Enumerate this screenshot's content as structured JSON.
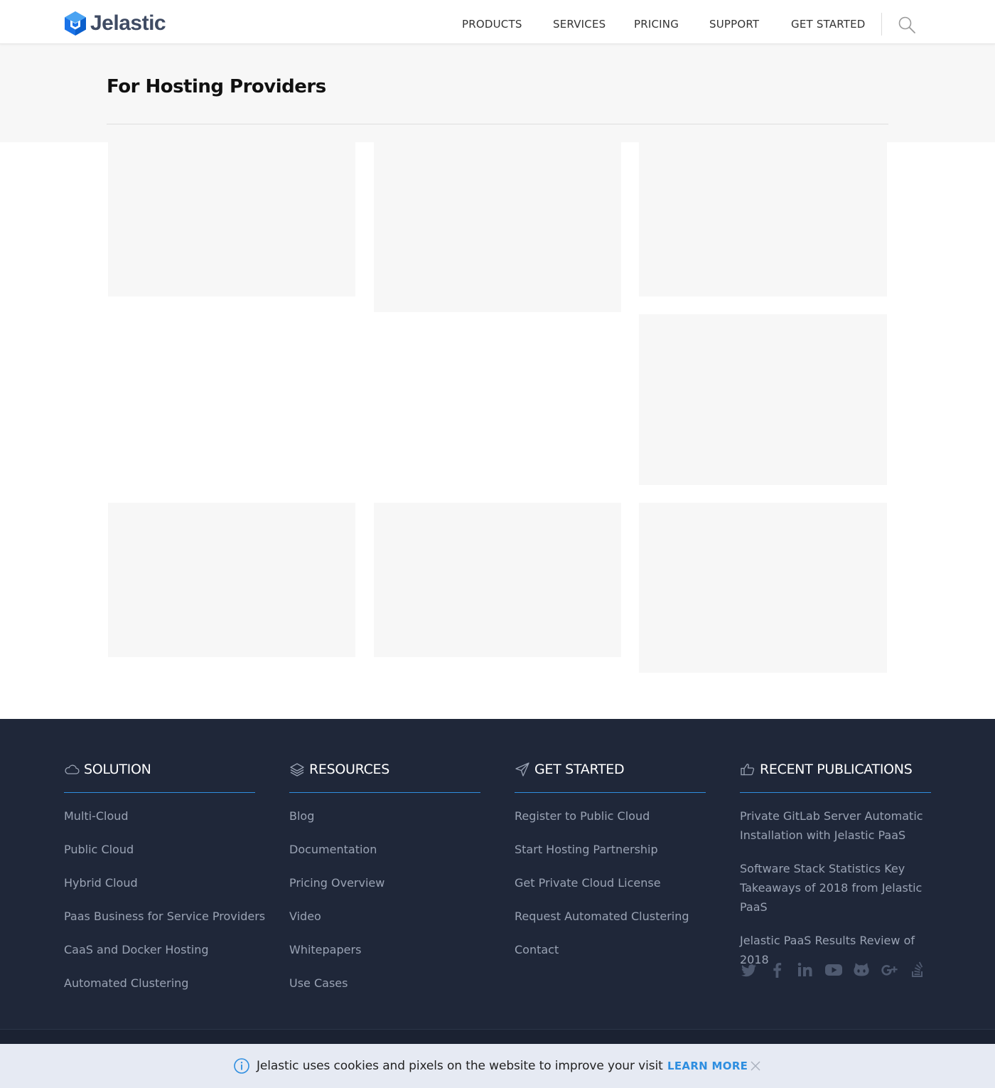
{
  "brand": {
    "name": "Jelastic",
    "accent": "#2e8ee0",
    "logo_color": "#1a73e8"
  },
  "nav": {
    "items": [
      "PRODUCTS",
      "SERVICES",
      "PRICING",
      "SUPPORT",
      "GET STARTED"
    ],
    "search_icon": "search-icon"
  },
  "page": {
    "title": "For Hosting Providers"
  },
  "footer": {
    "background": "#1f2739",
    "columns": [
      {
        "title": "SOLUTION",
        "icon": "cloud-icon",
        "links": [
          "Multi-Cloud",
          "Public Cloud",
          "Hybrid Cloud",
          "Paas Business for Service Providers",
          "CaaS and Docker Hosting",
          "Automated Clustering"
        ]
      },
      {
        "title": "RESOURCES",
        "icon": "layers-icon",
        "links": [
          "Blog",
          "Documentation",
          "Pricing Overview",
          "Video",
          "Whitepapers",
          "Use Cases"
        ]
      },
      {
        "title": "GET STARTED",
        "icon": "paper-plane-icon",
        "links": [
          "Register to Public Cloud",
          "Start Hosting Partnership",
          "Get Private Cloud License",
          "Request Automated Clustering",
          "Contact"
        ]
      },
      {
        "title": "RECENT PUBLICATIONS",
        "icon": "thumbs-up-icon",
        "links": [
          "Private GitLab Server Automatic Installation with Jelastic PaaS",
          "Software Stack Statistics Key Takeaways of 2018 from Jelastic PaaS",
          "Jelastic PaaS Results Review of 2018"
        ]
      }
    ],
    "social": [
      "twitter-icon",
      "facebook-icon",
      "linkedin-icon",
      "youtube-icon",
      "github-icon",
      "google-plus-icon",
      "stackoverflow-icon"
    ]
  },
  "cookie": {
    "text": "Jelastic uses cookies and pixels on the website to improve your visit",
    "link": "LEARN MORE",
    "info_icon": "info-icon",
    "close_icon": "close-icon"
  }
}
